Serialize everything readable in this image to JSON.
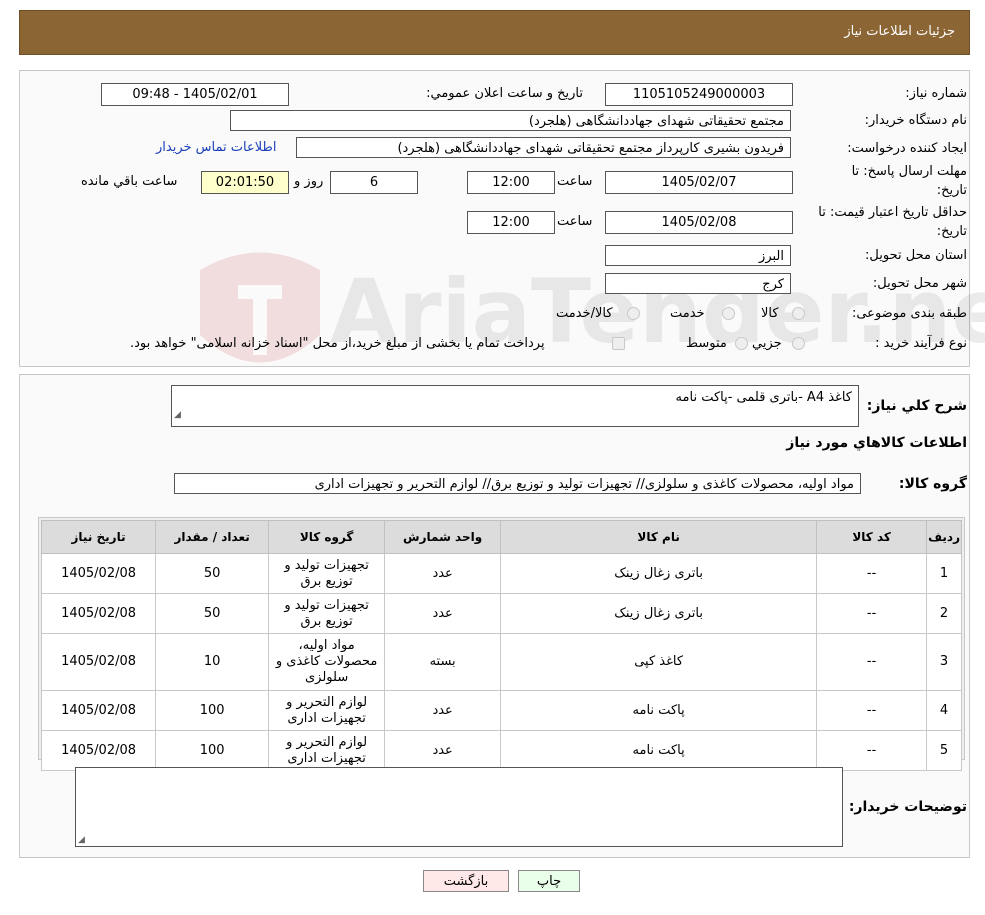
{
  "header": {
    "title": "جزئیات اطلاعات نیاز"
  },
  "form": {
    "need_number_label": "شماره نیاز:",
    "need_number": "1105105249000003",
    "announce_label": "تاریخ و ساعت اعلان عمومي:",
    "announce_value": "1405/02/01 - 09:48",
    "buyer_org_label": "نام دستگاه خريدار:",
    "buyer_org": "مجتمع تحقیقاتی شهدای جهاددانشگاهی (هلجرد)",
    "requester_label": "ايجاد کننده درخواست:",
    "requester": "فریدون بشیری کارپرداز مجتمع تحقیقاتی شهدای جهاددانشگاهی (هلجرد)",
    "contact_link": "اطلاعات تماس خريدار",
    "deadline_label_1": "مهلت ارسال پاسخ: تا",
    "deadline_label_2": "تاريخ:",
    "deadline_date": "1405/02/07",
    "time_label": "ساعت",
    "deadline_time": "12:00",
    "days_value": "6",
    "days_label": "روز و",
    "remaining_time": "02:01:50",
    "remaining_label": "ساعت باقي مانده",
    "validity_label_1": "حداقل تاريخ اعتبار قيمت: تا",
    "validity_label_2": "تاريخ:",
    "validity_date": "1405/02/08",
    "validity_time": "12:00",
    "province_label": "استان محل تحويل:",
    "province": "البرز",
    "city_label": "شهر محل تحويل:",
    "city": "کرج",
    "category_label": "طبقه بندی موضوعی:",
    "category_options": [
      "کالا",
      "خدمت",
      "کالا/خدمت"
    ],
    "process_label": "نوع فرآيند خريد :",
    "process_options": [
      "جزيي",
      "متوسط"
    ],
    "process_note": "پرداخت تمام يا بخشی از مبلغ خريد،از محل \"اسناد خزانه اسلامی\" خواهد بود."
  },
  "watermark": {
    "text": "AriaTender.neT"
  },
  "summary": {
    "description_label": "شرح کلي نياز:",
    "description": "کاغذ A4 -باتری قلمی -پاکت نامه",
    "goods_info_title": "اطلاعات کالاهاي مورد نياز",
    "goods_group_label": "گروه کالا:",
    "goods_group": "مواد اولیه، محصولات کاغذی و سلولزی// تجهیزات تولید و توزیع برق// لوازم التحریر و تجهیزات اداری"
  },
  "table": {
    "headers": [
      "رديف",
      "کد کالا",
      "نام کالا",
      "واحد شمارش",
      "گروه کالا",
      "تعداد / مقدار",
      "تاريخ نياز"
    ],
    "rows": [
      {
        "idx": "1",
        "code": "--",
        "name": "باتری زغال زینک",
        "unit": "عدد",
        "group": "تجهیزات تولید و توزیع برق",
        "qty": "50",
        "date": "1405/02/08"
      },
      {
        "idx": "2",
        "code": "--",
        "name": "باتری زغال زینک",
        "unit": "عدد",
        "group": "تجهیزات تولید و توزیع برق",
        "qty": "50",
        "date": "1405/02/08"
      },
      {
        "idx": "3",
        "code": "--",
        "name": "کاغذ کپی",
        "unit": "بسته",
        "group": "مواد اولیه، محصولات کاغذی و سلولزی",
        "qty": "10",
        "date": "1405/02/08"
      },
      {
        "idx": "4",
        "code": "--",
        "name": "پاکت نامه",
        "unit": "عدد",
        "group": "لوازم التحریر و تجهیزات اداری",
        "qty": "100",
        "date": "1405/02/08"
      },
      {
        "idx": "5",
        "code": "--",
        "name": "پاکت نامه",
        "unit": "عدد",
        "group": "لوازم التحریر و تجهیزات اداری",
        "qty": "100",
        "date": "1405/02/08"
      }
    ]
  },
  "notes": {
    "buyer_notes_label": "توضيحات خريدار:",
    "buyer_notes": ""
  },
  "buttons": {
    "print": "چاپ",
    "back": "بازگشت"
  },
  "colors": {
    "header_bg": "#8b6534",
    "link": "#1a3eb8",
    "remaining_bg": "#ffffcc",
    "print_bg": "#eaffea",
    "back_bg": "#ffe8e8"
  }
}
